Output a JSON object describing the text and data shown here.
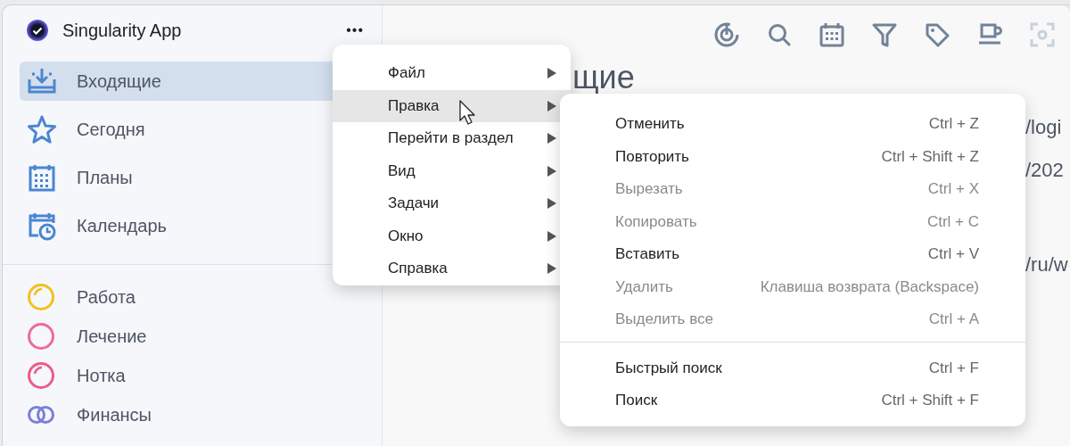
{
  "sidebar": {
    "app_name": "Singularity App",
    "more_button": "•••",
    "nav_items": [
      {
        "label": "Входящие",
        "selected": true,
        "kind": "inbox"
      },
      {
        "label": "Сегодня",
        "selected": false,
        "kind": "star"
      },
      {
        "label": "Планы",
        "selected": false,
        "kind": "plans"
      },
      {
        "label": "Календарь",
        "selected": false,
        "kind": "calendar"
      }
    ],
    "projects": [
      {
        "label": "Работа",
        "color": "#f5bf1f",
        "kind": "arc"
      },
      {
        "label": "Лечение",
        "color": "#ee6b95",
        "kind": "ring"
      },
      {
        "label": "Нотка",
        "color": "#ec5c88",
        "kind": "arc"
      },
      {
        "label": "Финансы",
        "color": "#7a7fd6",
        "kind": "double"
      }
    ]
  },
  "toolbar_buttons": [
    {
      "disabled": false
    },
    {
      "disabled": false
    },
    {
      "disabled": false
    },
    {
      "disabled": false
    },
    {
      "disabled": false
    },
    {
      "disabled": false
    },
    {
      "disabled": true
    }
  ],
  "main": {
    "heading": "щие",
    "fragments": [
      "/logi",
      "/202",
      "/ru/w"
    ]
  },
  "menu": {
    "items": [
      {
        "label": "Файл",
        "selected": false
      },
      {
        "label": "Правка",
        "selected": true
      },
      {
        "label": "Перейти в раздел",
        "selected": false
      },
      {
        "label": "Вид",
        "selected": false
      },
      {
        "label": "Задачи",
        "selected": false
      },
      {
        "label": "Окно",
        "selected": false
      },
      {
        "label": "Справка",
        "selected": false
      }
    ],
    "submenu_groups": [
      [
        {
          "label": "Отменить",
          "shortcut": "Ctrl + Z",
          "disabled": false
        },
        {
          "label": "Повторить",
          "shortcut": "Ctrl + Shift + Z",
          "disabled": false
        },
        {
          "label": "Вырезать",
          "shortcut": "Ctrl + X",
          "disabled": true
        },
        {
          "label": "Копировать",
          "shortcut": "Ctrl + C",
          "disabled": true
        },
        {
          "label": "Вставить",
          "shortcut": "Ctrl + V",
          "disabled": false
        },
        {
          "label": "Удалить",
          "shortcut": "Клавиша возврата (Backspace)",
          "disabled": true
        },
        {
          "label": "Выделить все",
          "shortcut": "Ctrl + A",
          "disabled": true
        }
      ],
      [
        {
          "label": "Быстрый поиск",
          "shortcut": "Ctrl + F",
          "disabled": false
        },
        {
          "label": "Поиск",
          "shortcut": "Ctrl + Shift + F",
          "disabled": false
        }
      ]
    ]
  }
}
